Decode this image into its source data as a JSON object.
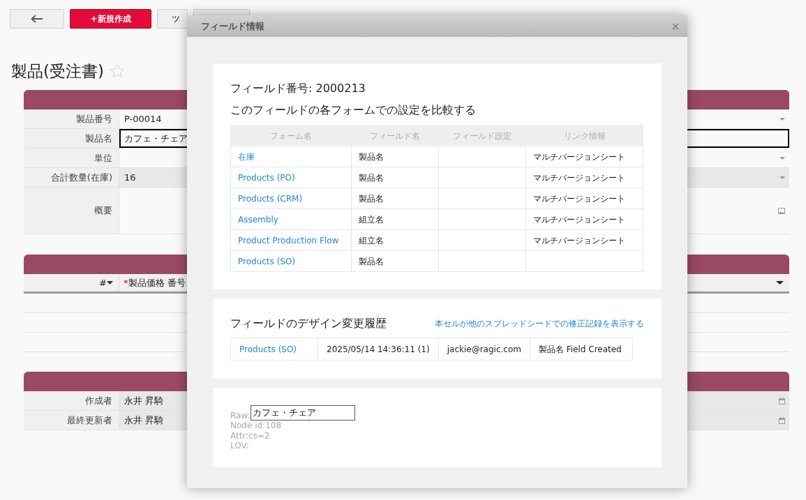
{
  "toolbar": {
    "buttons": [
      {
        "kind": "back"
      },
      {
        "kind": "primary",
        "label": "+新規作成"
      },
      {
        "kind": "plain",
        "label": "ツ"
      },
      {
        "kind": "plain"
      }
    ]
  },
  "page_title": "製品(受注書)",
  "favorite": false,
  "sections": [
    {
      "kind": "fields",
      "fields": [
        {
          "label": "製品番号",
          "value": "P-00014",
          "kind": "dropdown",
          "readonly": false,
          "selected": false
        },
        {
          "label": "製品名",
          "value": "カフェ・チェア",
          "kind": "text",
          "readonly": false,
          "selected": true
        },
        {
          "label": "単位",
          "kind": "dropdown",
          "readonly": false,
          "selected": false
        },
        {
          "label": "合計数量(在庫)",
          "value": "16",
          "kind": "dropdown",
          "readonly": true,
          "selected": false
        },
        {
          "label": "概要",
          "kind": "image",
          "readonly": false,
          "selected": false
        }
      ]
    },
    {
      "kind": "subtable",
      "columns": [
        {
          "label": "#",
          "sortable": true
        },
        {
          "label": "製品価格 番号",
          "sortable": false,
          "required_mark": "*"
        }
      ]
    },
    {
      "kind": "fields",
      "fields": [
        {
          "label": "作成者",
          "value": "永井 昇騎",
          "kind": "date",
          "readonly": true,
          "selected": false
        },
        {
          "label": "最終更新者",
          "value": "永井 昇騎",
          "kind": "date",
          "readonly": true,
          "selected": false
        }
      ]
    }
  ],
  "dialog": {
    "title": "フィールド情報",
    "field_number": "フィールド番号: 2000213",
    "compare_heading": "このフィールドの各フォームでの設定を比較する",
    "compare_table": {
      "columns": [
        "フォーム名",
        "フィールド名",
        "フィールド設定",
        "リンク情報"
      ],
      "rows": [
        {
          "form": "在庫",
          "field_name": "製品名",
          "link_info": "マルチバージョンシート"
        },
        {
          "form": "Products (PO)",
          "field_name": "製品名",
          "link_info": "マルチバージョンシート"
        },
        {
          "form": "Products (CRM)",
          "field_name": "製品名",
          "link_info": "マルチバージョンシート"
        },
        {
          "form": "Assembly",
          "field_name": "組立名",
          "link_info": "マルチバージョンシート"
        },
        {
          "form": "Product Production Flow",
          "field_name": "組立名",
          "link_info": "マルチバージョンシート"
        },
        {
          "form": "Products (SO)",
          "field_name": "製品名"
        }
      ]
    },
    "history_heading": "フィールドのデザイン変更履歴",
    "history_link": "本セルが他のスプレッドシードでの修正記録を表示する",
    "history_rows": [
      {
        "form": "Products (SO)",
        "time": "2025/05/14 14:36:11 (1)",
        "user": "jackie@ragic.com",
        "action": "製品名 Field Created"
      }
    ],
    "debug": {
      "raw_label": "Raw:",
      "raw_value": "カフェ・チェア",
      "lines": [
        "Node id:108",
        "Attr:cs=2",
        "LOV:"
      ]
    }
  }
}
